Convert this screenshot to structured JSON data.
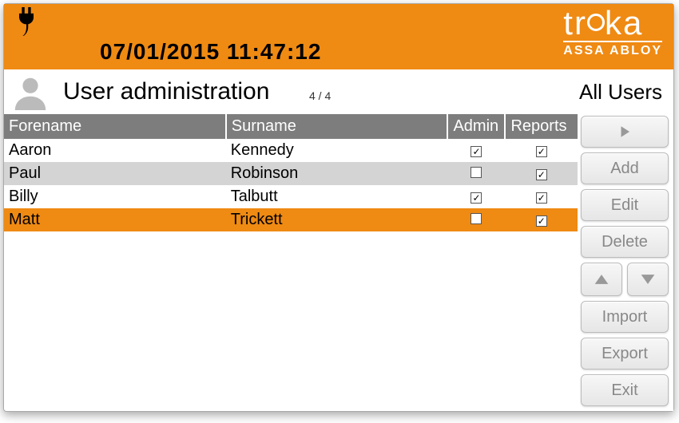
{
  "colors": {
    "accent": "#ef8a13"
  },
  "header": {
    "datetime": "07/01/2015 11:47:12",
    "brand_top": "traka",
    "brand_bottom": "ASSA ABLOY"
  },
  "page": {
    "title": "User administration",
    "counter": "4 / 4",
    "filter_label": "All Users"
  },
  "table": {
    "headers": {
      "forename": "Forename",
      "surname": "Surname",
      "admin": "Admin",
      "reports": "Reports"
    },
    "rows": [
      {
        "forename": "Aaron",
        "surname": "Kennedy",
        "admin": true,
        "reports": true,
        "state": "even"
      },
      {
        "forename": "Paul",
        "surname": "Robinson",
        "admin": false,
        "reports": true,
        "state": "odd"
      },
      {
        "forename": "Billy",
        "surname": "Talbutt",
        "admin": true,
        "reports": true,
        "state": "even"
      },
      {
        "forename": "Matt",
        "surname": "Trickett",
        "admin": false,
        "reports": true,
        "state": "sel"
      }
    ]
  },
  "sidebar": {
    "add": "Add",
    "edit": "Edit",
    "delete": "Delete",
    "import": "Import",
    "export": "Export",
    "exit": "Exit"
  }
}
